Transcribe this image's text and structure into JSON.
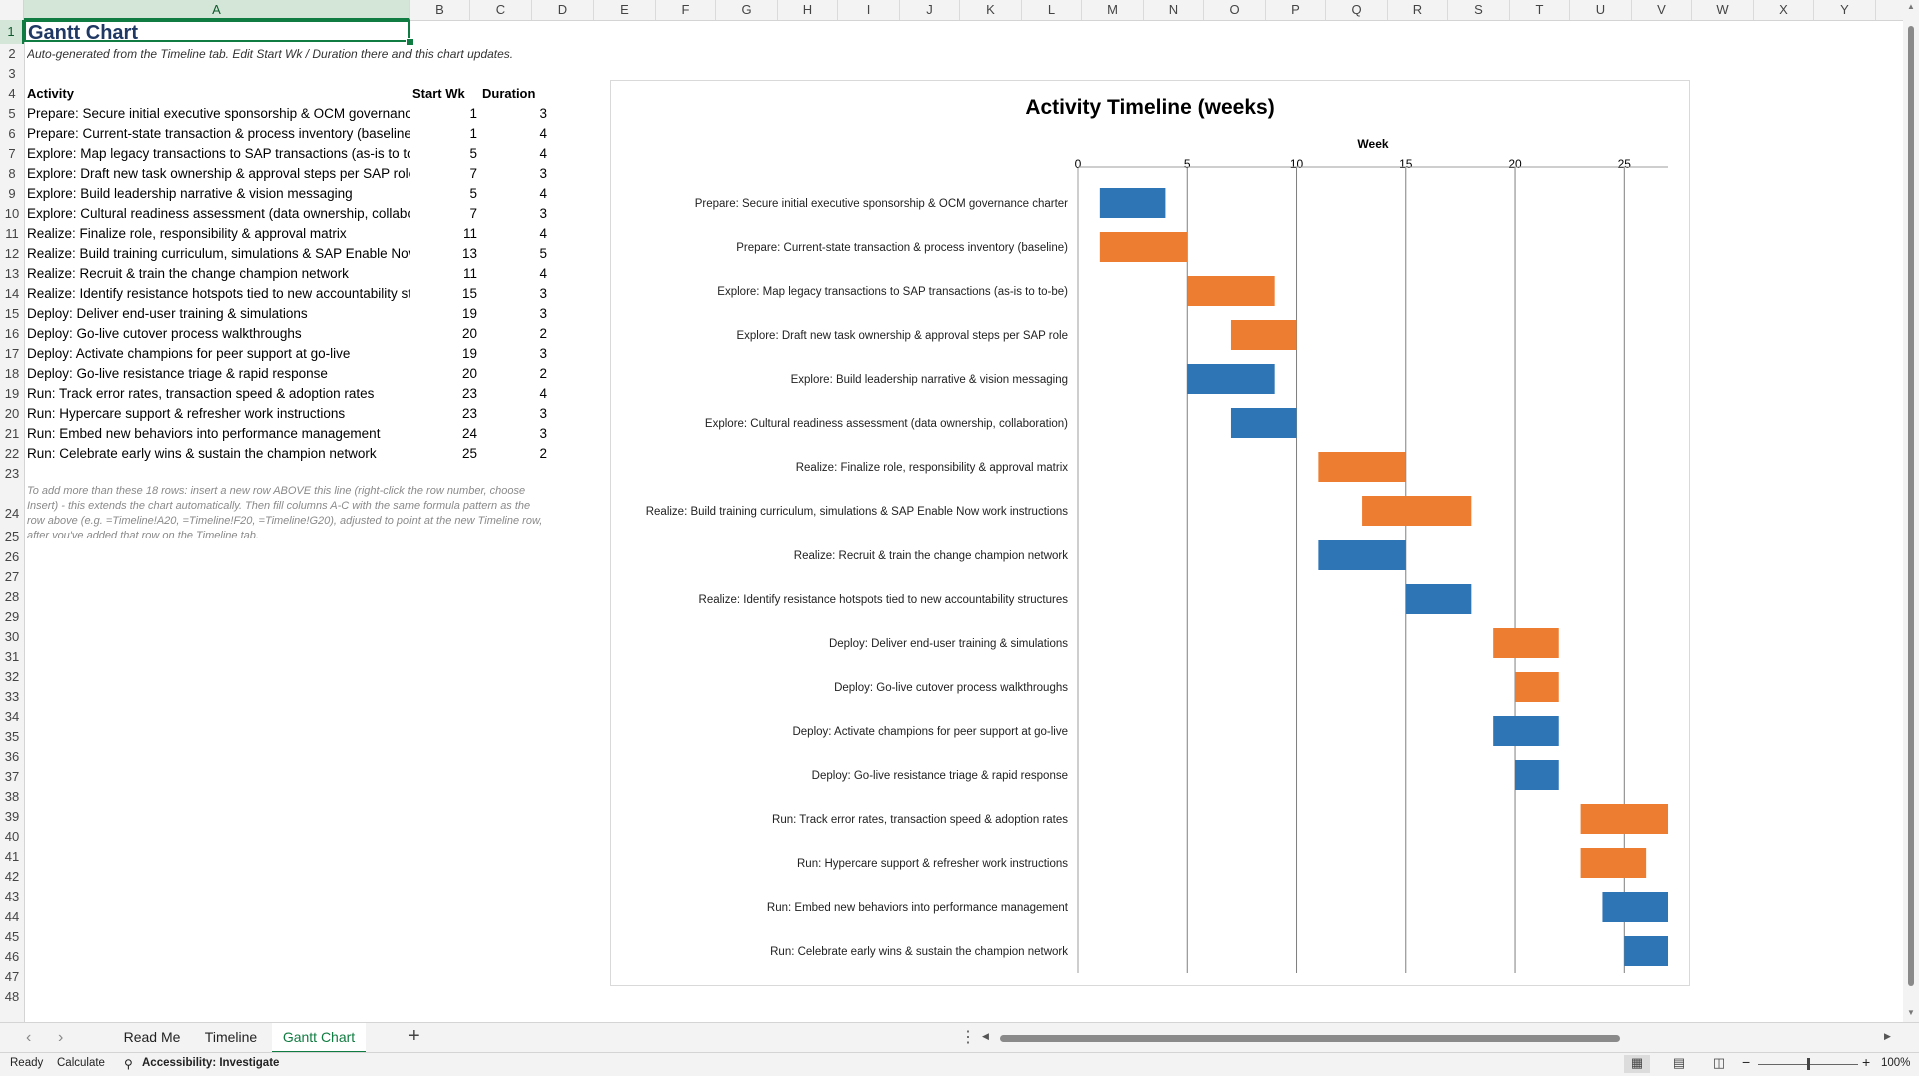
{
  "sheet": {
    "columns": [
      "A",
      "B",
      "C",
      "D",
      "E",
      "F",
      "G",
      "H",
      "I",
      "J",
      "K",
      "L",
      "M",
      "N",
      "O",
      "P",
      "Q",
      "R",
      "S",
      "T",
      "U",
      "V",
      "W",
      "X",
      "Y"
    ],
    "title": "Gantt Chart",
    "subtitle": "Auto-generated from the Timeline tab. Edit Start Wk / Duration there and this chart updates.",
    "headers": {
      "activity": "Activity",
      "start": "Start Wk",
      "duration": "Duration"
    },
    "rows": [
      {
        "activity": "Prepare: Secure initial executive sponsorship & OCM governance charter",
        "start": 1,
        "duration": 3
      },
      {
        "activity": "Prepare: Current-state transaction & process inventory (baseline)",
        "start": 1,
        "duration": 4
      },
      {
        "activity": "Explore: Map legacy transactions to SAP transactions (as-is to to-be)",
        "start": 5,
        "duration": 4
      },
      {
        "activity": "Explore: Draft new task ownership & approval steps per SAP role",
        "start": 7,
        "duration": 3
      },
      {
        "activity": "Explore: Build leadership narrative & vision messaging",
        "start": 5,
        "duration": 4
      },
      {
        "activity": "Explore: Cultural readiness assessment (data ownership, collaboration)",
        "start": 7,
        "duration": 3
      },
      {
        "activity": "Realize: Finalize role, responsibility & approval matrix",
        "start": 11,
        "duration": 4
      },
      {
        "activity": "Realize: Build training curriculum, simulations & SAP Enable Now work instructions",
        "start": 13,
        "duration": 5
      },
      {
        "activity": "Realize: Recruit & train the change champion network",
        "start": 11,
        "duration": 4
      },
      {
        "activity": "Realize: Identify resistance hotspots tied to new accountability structures",
        "start": 15,
        "duration": 3
      },
      {
        "activity": "Deploy: Deliver end-user training & simulations",
        "start": 19,
        "duration": 3
      },
      {
        "activity": "Deploy: Go-live cutover process walkthroughs",
        "start": 20,
        "duration": 2
      },
      {
        "activity": "Deploy: Activate champions for peer support at go-live",
        "start": 19,
        "duration": 3
      },
      {
        "activity": "Deploy: Go-live resistance triage & rapid response",
        "start": 20,
        "duration": 2
      },
      {
        "activity": "Run: Track error rates, transaction speed & adoption rates",
        "start": 23,
        "duration": 4
      },
      {
        "activity": "Run: Hypercare support & refresher work instructions",
        "start": 23,
        "duration": 3
      },
      {
        "activity": "Run: Embed new behaviors into performance management",
        "start": 24,
        "duration": 3
      },
      {
        "activity": "Run: Celebrate early wins & sustain the champion network",
        "start": 25,
        "duration": 2
      }
    ],
    "note": "To add more than these 18 rows: insert a new row ABOVE this line (right-click the row number, choose Insert) - this extends the chart automatically. Then fill columns A-C with the same formula pattern as the row above (e.g. =Timeline!A20, =Timeline!F20, =Timeline!G20), adjusted to point at the new Timeline row, after you've added that row on the Timeline tab."
  },
  "chart_data": {
    "type": "bar",
    "orientation": "horizontal",
    "title": "Activity Timeline (weeks)",
    "xlabel": "Week",
    "xlim": [
      0,
      27
    ],
    "xticks": [
      0,
      5,
      10,
      15,
      20,
      25
    ],
    "grid": true,
    "legend": "none",
    "colors": {
      "orange": "#ed7d31",
      "blue": "#2e75b6"
    },
    "bars": [
      {
        "label": "Prepare: Secure initial executive sponsorship & OCM governance charter",
        "start": 1,
        "end": 4,
        "color": "blue"
      },
      {
        "label": "Prepare: Current-state transaction & process inventory (baseline)",
        "start": 1,
        "end": 5,
        "color": "orange"
      },
      {
        "label": "Explore: Map legacy transactions to SAP transactions (as-is to to-be)",
        "start": 5,
        "end": 9,
        "color": "orange"
      },
      {
        "label": "Explore: Draft new task ownership & approval steps per SAP role",
        "start": 7,
        "end": 10,
        "color": "orange"
      },
      {
        "label": "Explore: Build leadership narrative & vision messaging",
        "start": 5,
        "end": 9,
        "color": "blue"
      },
      {
        "label": "Explore: Cultural readiness assessment (data ownership, collaboration)",
        "start": 7,
        "end": 10,
        "color": "blue"
      },
      {
        "label": "Realize: Finalize role, responsibility & approval matrix",
        "start": 11,
        "end": 15,
        "color": "orange"
      },
      {
        "label": "Realize: Build training curriculum, simulations & SAP Enable Now work instructions",
        "start": 13,
        "end": 18,
        "color": "orange"
      },
      {
        "label": "Realize: Recruit & train the change champion network",
        "start": 11,
        "end": 15,
        "color": "blue"
      },
      {
        "label": "Realize: Identify resistance hotspots tied to new accountability structures",
        "start": 15,
        "end": 18,
        "color": "blue"
      },
      {
        "label": "Deploy: Deliver end-user training & simulations",
        "start": 19,
        "end": 22,
        "color": "orange"
      },
      {
        "label": "Deploy: Go-live cutover process walkthroughs",
        "start": 20,
        "end": 22,
        "color": "orange"
      },
      {
        "label": "Deploy: Activate champions for peer support at go-live",
        "start": 19,
        "end": 22,
        "color": "blue"
      },
      {
        "label": "Deploy: Go-live resistance triage & rapid response",
        "start": 20,
        "end": 22,
        "color": "blue"
      },
      {
        "label": "Run: Track error rates, transaction speed & adoption rates",
        "start": 23,
        "end": 27,
        "color": "orange"
      },
      {
        "label": "Run: Hypercare support & refresher work instructions",
        "start": 23,
        "end": 26,
        "color": "orange"
      },
      {
        "label": "Run: Embed new behaviors into performance management",
        "start": 24,
        "end": 27,
        "color": "blue"
      },
      {
        "label": "Run: Celebrate early wins & sustain the champion network",
        "start": 25,
        "end": 27,
        "color": "blue"
      }
    ]
  },
  "tabs": [
    {
      "label": "Read Me",
      "active": false
    },
    {
      "label": "Timeline",
      "active": false
    },
    {
      "label": "Gantt Chart",
      "active": true
    }
  ],
  "status": {
    "ready": "Ready",
    "calculate": "Calculate",
    "accessibility": "Accessibility: Investigate",
    "zoom": "100%",
    "icons": [
      "accessibility-icon",
      "normal-view-icon",
      "page-layout-icon",
      "page-break-icon"
    ]
  },
  "colors": {
    "accent": "#107c41",
    "title": "#1f3864"
  }
}
